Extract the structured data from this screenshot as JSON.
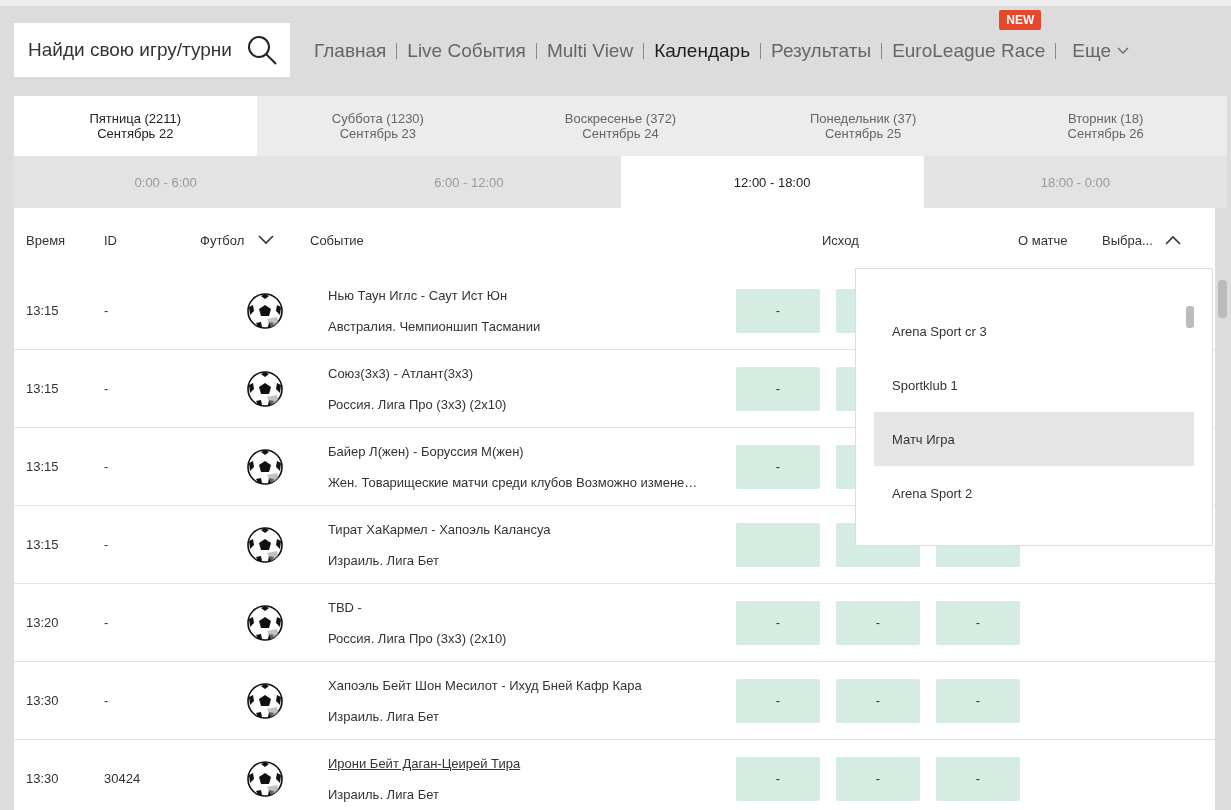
{
  "search": {
    "placeholder": "Найди свою игру/турни"
  },
  "nav": [
    {
      "label": "Главная",
      "selected": false
    },
    {
      "label": "Live События",
      "selected": false
    },
    {
      "label": "Multi View",
      "selected": false
    },
    {
      "label": "Календарь",
      "selected": true
    },
    {
      "label": "Результаты",
      "selected": false
    },
    {
      "label": "EuroLeague Race",
      "selected": false,
      "badge": "NEW"
    },
    {
      "label": "Еще",
      "selected": false,
      "kind": "menu"
    }
  ],
  "days": [
    {
      "day": "Пятница (2211)",
      "date": "Сентябрь 22",
      "selected": true
    },
    {
      "day": "Суббота (1230)",
      "date": "Сентябрь 23",
      "selected": false
    },
    {
      "day": "Воскресенье (372)",
      "date": "Сентябрь 24",
      "selected": false
    },
    {
      "day": "Понедельник (37)",
      "date": "Сентябрь 25",
      "selected": false
    },
    {
      "day": "Вторник (18)",
      "date": "Сентябрь 26",
      "selected": false
    }
  ],
  "time_ranges": [
    {
      "label": "0:00 - 6:00",
      "selected": false
    },
    {
      "label": "6:00 - 12:00",
      "selected": false
    },
    {
      "label": "12:00 - 18:00",
      "selected": true
    },
    {
      "label": "18:00 - 0:00",
      "selected": false
    }
  ],
  "table": {
    "columns": [
      "Время",
      "ID",
      "Футбол",
      "Событие",
      "Исход",
      "О матче",
      "Выбра..."
    ],
    "rows": [
      {
        "time": "13:15",
        "id": "-",
        "event": "Нью Таун Иглс - Саут Ист Юн",
        "league": "Австралия. Чемпионшип Тасмании",
        "linked": false,
        "odds": [
          "-"
        ],
        "under_menu": true
      },
      {
        "time": "13:15",
        "id": "-",
        "event": "Союз(3х3) - Атлант(3х3)",
        "league": "Россия. Лига Про (3х3) (2х10)",
        "linked": false,
        "odds": [
          "-"
        ],
        "under_menu": true
      },
      {
        "time": "13:15",
        "id": "-",
        "event": "Байер Л(жен) - Боруссия М(жен)",
        "league": "Жен. Товарищеские матчи среди клубов Возможно измене…",
        "linked": false,
        "odds": [
          "-"
        ],
        "under_menu": true
      },
      {
        "time": "13:15",
        "id": "-",
        "event": "Тират ХаКармел - Хапоэль Калансуа",
        "league": "Израиль. Лига Бет",
        "linked": false
      },
      {
        "time": "13:20",
        "id": "-",
        "event": "TBD -",
        "league": "Россия. Лига Про (3х3) (2х10)",
        "linked": false,
        "odds": [
          "-",
          "-",
          "-"
        ]
      },
      {
        "time": "13:30",
        "id": "-",
        "event": "Хапоэль Бейт Шон Месилот - Ихуд Бней Кафр Кара",
        "league": "Израиль. Лига Бет",
        "linked": false,
        "odds": [
          "-",
          "-",
          "-"
        ]
      },
      {
        "time": "13:30",
        "id": "30424",
        "event": "Ирони Бейт Даган-Цеирей Тира",
        "league": "Израиль. Лига Бет",
        "linked": true,
        "odds": [
          "-",
          "-",
          "-"
        ]
      }
    ]
  },
  "channel_menu": {
    "items": [
      {
        "label": "Arena Sport cr 3",
        "selected": false
      },
      {
        "label": "Sportklub 1",
        "selected": false
      },
      {
        "label": "Матч Игра",
        "selected": true
      },
      {
        "label": "Arena Sport 2",
        "selected": false
      }
    ]
  }
}
